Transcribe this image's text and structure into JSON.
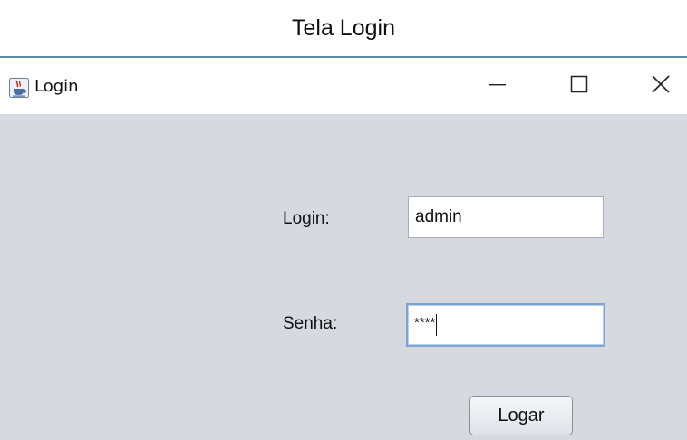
{
  "caption": "Tela Login",
  "window": {
    "title": "Login",
    "app_icon": "java-coffee-cup-icon",
    "controls": {
      "minimize_icon": "minimize-icon",
      "maximize_icon": "maximize-icon",
      "close_icon": "close-icon"
    }
  },
  "form": {
    "login_label": "Login:",
    "login_value": "admin",
    "senha_label": "Senha:",
    "senha_value": "****",
    "submit_label": "Logar"
  },
  "colors": {
    "content_background": "#d6d9e0",
    "window_border": "#5a8aa8",
    "focus_border": "#7ca4cf"
  }
}
